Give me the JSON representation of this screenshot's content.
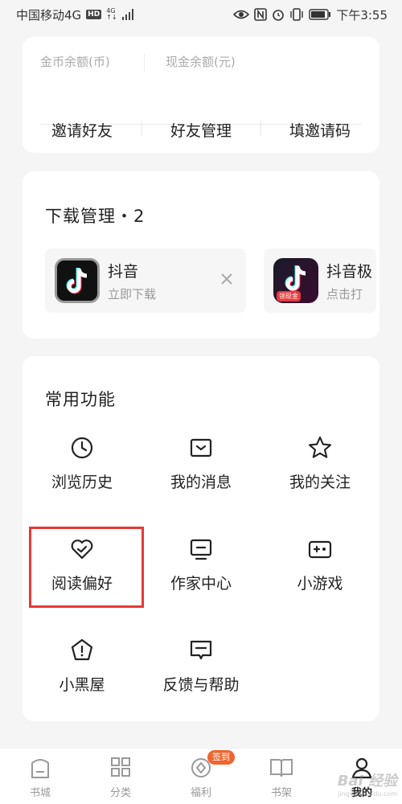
{
  "status_bar": {
    "carrier": "中国移动4G",
    "hd": "HD",
    "net_top": "4G",
    "net_bottom": "↑↓",
    "time": "下午3:55"
  },
  "account_card": {
    "coin_balance_label": "金币余额(币)",
    "cash_balance_label": "现金余额(元)",
    "invite_friends": "邀请好友",
    "friend_management": "好友管理",
    "enter_invite_code": "填邀请码"
  },
  "download_card": {
    "title": "下载管理・2",
    "items": [
      {
        "name": "抖音",
        "status": "立即下载",
        "icon": "douyin-icon"
      },
      {
        "name": "抖音极",
        "status": "点击打",
        "icon": "douyin-lite-icon",
        "badge": "领现金"
      }
    ]
  },
  "features_card": {
    "title": "常用功能",
    "items": [
      {
        "label": "浏览历史",
        "icon": "clock-icon"
      },
      {
        "label": "我的消息",
        "icon": "message-box-icon"
      },
      {
        "label": "我的关注",
        "icon": "star-icon"
      },
      {
        "label": "阅读偏好",
        "icon": "heart-check-icon"
      },
      {
        "label": "作家中心",
        "icon": "monitor-icon"
      },
      {
        "label": "小游戏",
        "icon": "gamepad-icon"
      },
      {
        "label": "小黑屋",
        "icon": "pentagon-alert-icon"
      },
      {
        "label": "反馈与帮助",
        "icon": "feedback-bubble-icon"
      }
    ],
    "highlighted_item": "阅读偏好",
    "highlight_color": "#e53935"
  },
  "tab_bar": {
    "tabs": [
      {
        "label": "书城",
        "icon": "bookstore-icon"
      },
      {
        "label": "分类",
        "icon": "grid-icon"
      },
      {
        "label": "福利",
        "icon": "coin-icon"
      },
      {
        "label": "书架",
        "icon": "book-icon"
      },
      {
        "label": "我的",
        "icon": "person-icon"
      }
    ],
    "active_tab": "我的",
    "welfare_badge": "签到",
    "badge_color": "#f0652d"
  },
  "watermark": {
    "text": "Bai 经验",
    "sub": "jingyan.baidu.com"
  }
}
